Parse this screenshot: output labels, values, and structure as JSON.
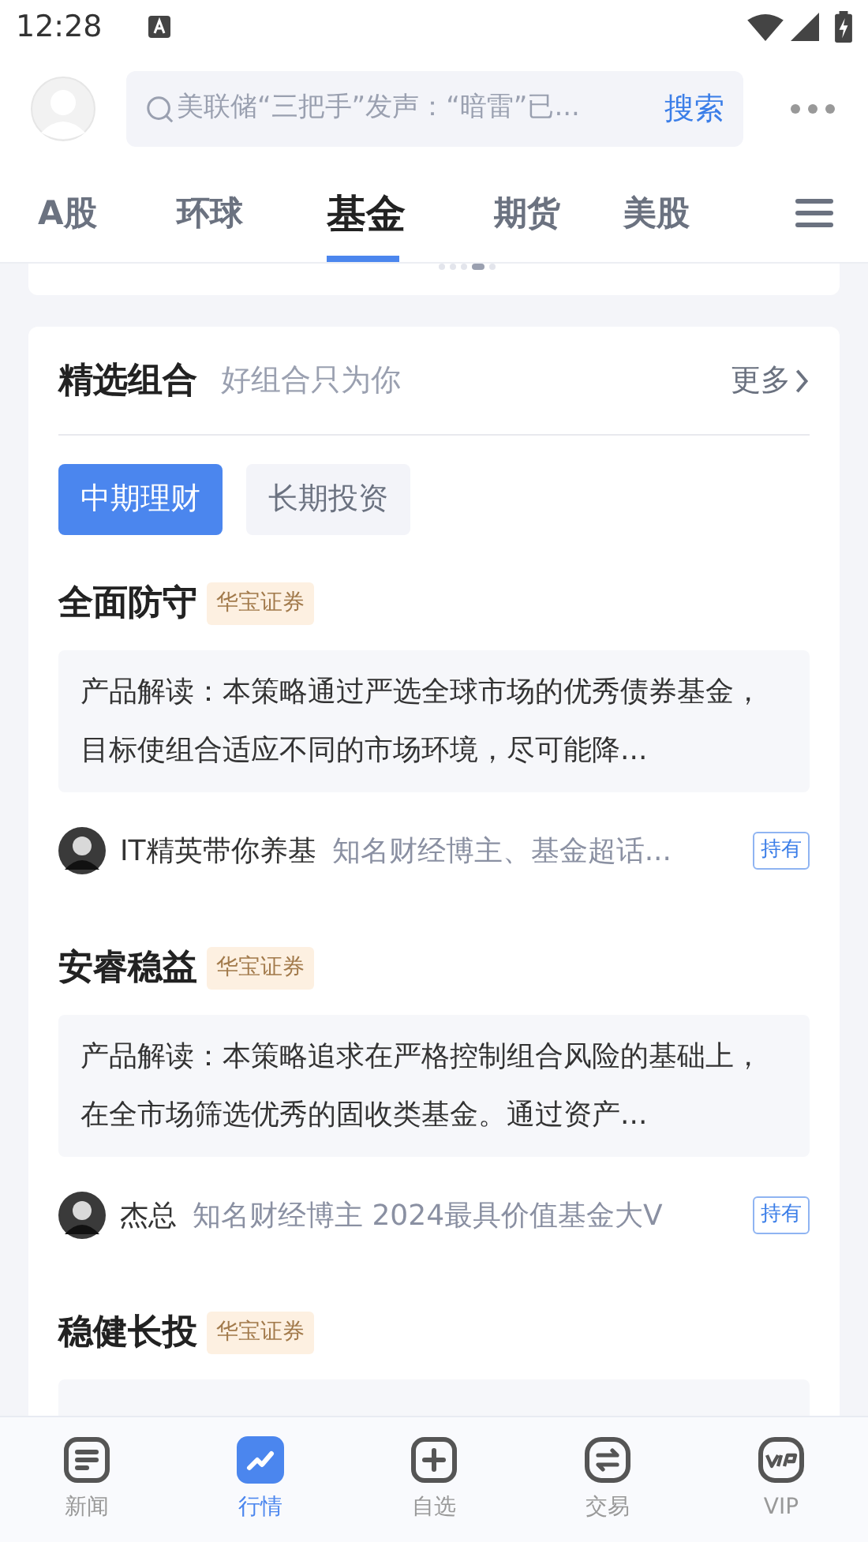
{
  "status_bar": {
    "time": "12:28"
  },
  "search": {
    "placeholder": "美联储“三把手”发声：“暗雷”已...",
    "button": "搜索"
  },
  "tabs": [
    {
      "label": "A股",
      "selected": false
    },
    {
      "label": "环球",
      "selected": false
    },
    {
      "label": "基金",
      "selected": true
    },
    {
      "label": "期货",
      "selected": false
    },
    {
      "label": "美股",
      "selected": false
    }
  ],
  "banner_dots": [
    {
      "selected": false
    },
    {
      "selected": false
    },
    {
      "selected": false
    },
    {
      "selected": true
    },
    {
      "selected": false
    }
  ],
  "section": {
    "title": "精选组合",
    "subtitle": "好组合只为你",
    "more": "更多",
    "filters": [
      {
        "label": "中期理财",
        "selected": true
      },
      {
        "label": "长期投资",
        "selected": false
      }
    ],
    "portfolios": [
      {
        "name": "全面防守",
        "tag": "华宝证券",
        "description": "产品解读：本策略通过严选全球市场的优秀债券基金，目标使组合适应不同的市场环境，尽可能降...",
        "author": "IT精英带你养基",
        "author_bio": "知名财经博主、基金超话...",
        "badge": "持有"
      },
      {
        "name": "安睿稳益",
        "tag": "华宝证券",
        "description": "产品解读：本策略追求在严格控制组合风险的基础上，在全市场筛选优秀的固收类基金。通过资产...",
        "author": "杰总",
        "author_bio": "知名财经博主 2024最具价值基金大V",
        "badge": "持有"
      },
      {
        "name": "稳健长投",
        "tag": "华宝证券"
      }
    ]
  },
  "bottom_nav": [
    {
      "label": "新闻",
      "kind": "news",
      "selected": false
    },
    {
      "label": "行情",
      "kind": "market",
      "selected": true
    },
    {
      "label": "自选",
      "kind": "watchlist",
      "selected": false
    },
    {
      "label": "交易",
      "kind": "trade",
      "selected": false
    },
    {
      "label": "VIP",
      "kind": "vip",
      "selected": false
    }
  ]
}
